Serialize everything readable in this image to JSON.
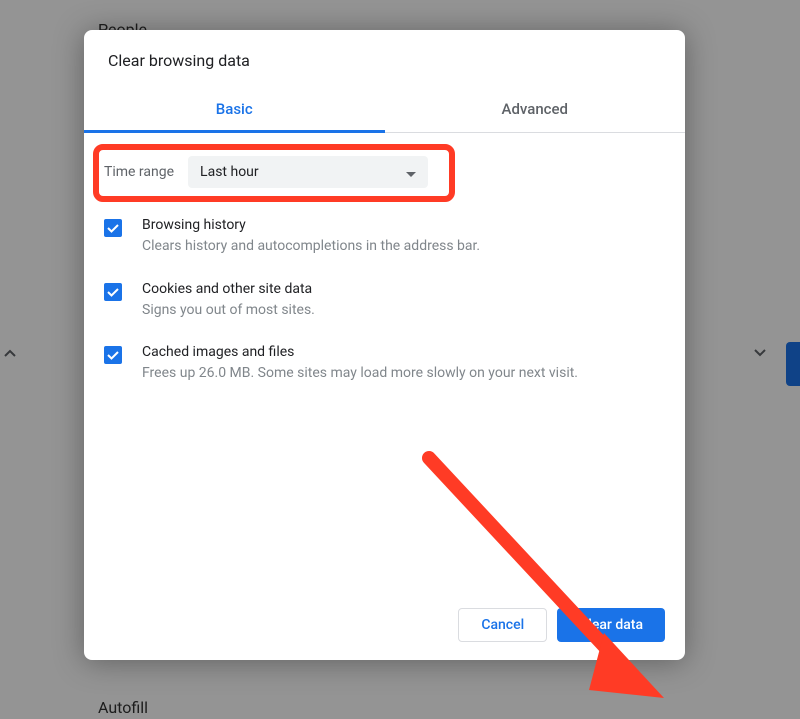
{
  "background": {
    "people_label": "People",
    "autofill_label": "Autofill"
  },
  "dialog": {
    "title": "Clear browsing data",
    "tabs": {
      "basic": "Basic",
      "advanced": "Advanced"
    },
    "time_range": {
      "label": "Time range",
      "selected": "Last hour"
    },
    "items": [
      {
        "title": "Browsing history",
        "description": "Clears history and autocompletions in the address bar."
      },
      {
        "title": "Cookies and other site data",
        "description": "Signs you out of most sites."
      },
      {
        "title": "Cached images and files",
        "description": "Frees up 26.0 MB. Some sites may load more slowly on your next visit."
      }
    ],
    "buttons": {
      "cancel": "Cancel",
      "clear": "Clear data"
    }
  },
  "annotation": {
    "highlight_color": "#ff3b25",
    "arrow_color": "#ff3b25"
  }
}
